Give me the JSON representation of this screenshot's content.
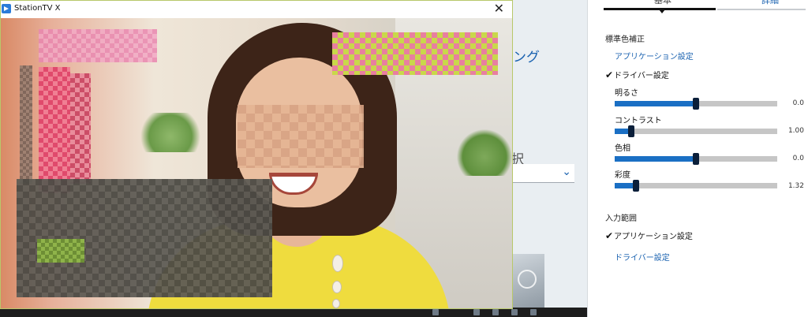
{
  "tv_window": {
    "title": "StationTV X",
    "close_glyph": "✕"
  },
  "background_app": {
    "heading_fragment": "ング",
    "label_fragment": "択",
    "dropdown_chevron": "⌄"
  },
  "panel": {
    "tabs": [
      {
        "label": "基本",
        "active": true
      },
      {
        "label": "詳細",
        "active": false
      }
    ],
    "color_correction": {
      "heading": "標準色補正",
      "app_settings_link": "アプリケーション設定",
      "driver_settings_check": "ドライバー設定",
      "check_mark": "✔",
      "sliders": [
        {
          "label": "明るさ",
          "value": 0.0,
          "display": "0.0",
          "min": -1.0,
          "max": 1.0
        },
        {
          "label": "コントラスト",
          "value": 1.0,
          "display": "1.00",
          "min": 0.0,
          "max": 10.0
        },
        {
          "label": "色相",
          "value": 0.0,
          "display": "0.0",
          "min": -1.0,
          "max": 1.0
        },
        {
          "label": "彩度",
          "value": 1.32,
          "display": "1.32",
          "min": 0.0,
          "max": 10.0
        }
      ]
    },
    "input_range": {
      "heading": "入力範囲",
      "app_settings_check": "アプリケーション設定",
      "check_mark": "✔",
      "driver_settings_link": "ドライバー設定"
    }
  },
  "colors": {
    "accent_blue": "#1a62b0",
    "slider_fill": "#1a6fc4",
    "slider_thumb": "#0b1f3a",
    "slider_track": "#c6c6c6"
  }
}
